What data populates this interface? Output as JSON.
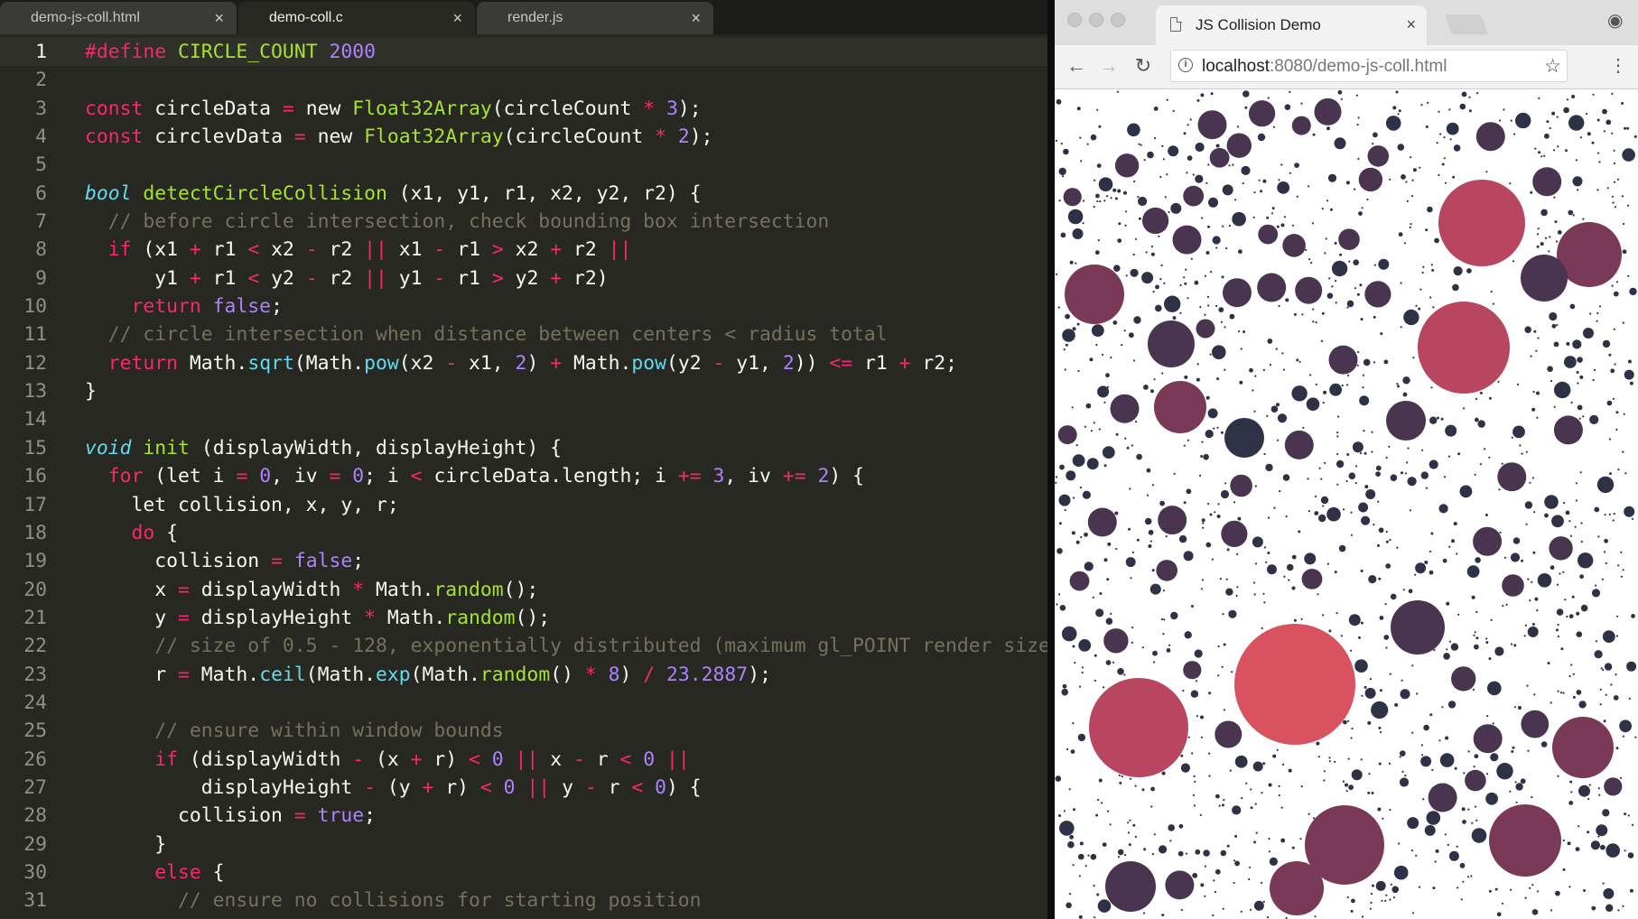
{
  "editor": {
    "tabs": [
      {
        "label": "demo-js-coll.html",
        "close": "×",
        "active": false
      },
      {
        "label": "demo-coll.c",
        "close": "×",
        "active": true
      },
      {
        "label": "render.js",
        "close": "×",
        "active": false
      }
    ],
    "current_line": 1,
    "lines": [
      {
        "n": "1",
        "segs": [
          [
            "kw",
            "#define "
          ],
          [
            "fn",
            "CIRCLE_COUNT "
          ],
          [
            "num",
            "2000"
          ]
        ]
      },
      {
        "n": "2",
        "segs": []
      },
      {
        "n": "3",
        "segs": [
          [
            "kw",
            "const "
          ],
          [
            "",
            "circleData "
          ],
          [
            "kw",
            "= "
          ],
          [
            "",
            "new "
          ],
          [
            "fn",
            "Float32Array"
          ],
          [
            "",
            "(circleCount "
          ],
          [
            "kw",
            "* "
          ],
          [
            "num",
            "3"
          ],
          [
            "",
            ");"
          ]
        ]
      },
      {
        "n": "4",
        "segs": [
          [
            "kw",
            "const "
          ],
          [
            "",
            "circlevData "
          ],
          [
            "kw",
            "= "
          ],
          [
            "",
            "new "
          ],
          [
            "fn",
            "Float32Array"
          ],
          [
            "",
            "(circleCount "
          ],
          [
            "kw",
            "* "
          ],
          [
            "num",
            "2"
          ],
          [
            "",
            ");"
          ]
        ]
      },
      {
        "n": "5",
        "segs": []
      },
      {
        "n": "6",
        "segs": [
          [
            "italic-kw",
            "bool "
          ],
          [
            "fn",
            "detectCircleCollision "
          ],
          [
            "",
            "(x1, y1, r1, x2, y2, r2) {"
          ]
        ]
      },
      {
        "n": "7",
        "segs": [
          [
            "cm",
            "  // before circle intersection, check bounding box intersection"
          ]
        ]
      },
      {
        "n": "8",
        "segs": [
          [
            "kw",
            "  if "
          ],
          [
            "",
            "(x1 "
          ],
          [
            "kw",
            "+ "
          ],
          [
            "",
            "r1 "
          ],
          [
            "kw",
            "< "
          ],
          [
            "",
            "x2 "
          ],
          [
            "kw",
            "- "
          ],
          [
            "",
            "r2 "
          ],
          [
            "kw",
            "|| "
          ],
          [
            "",
            "x1 "
          ],
          [
            "kw",
            "- "
          ],
          [
            "",
            "r1 "
          ],
          [
            "kw",
            "> "
          ],
          [
            "",
            "x2 "
          ],
          [
            "kw",
            "+ "
          ],
          [
            "",
            "r2 "
          ],
          [
            "kw",
            "||"
          ]
        ]
      },
      {
        "n": "9",
        "segs": [
          [
            "",
            "      y1 "
          ],
          [
            "kw",
            "+ "
          ],
          [
            "",
            "r1 "
          ],
          [
            "kw",
            "< "
          ],
          [
            "",
            "y2 "
          ],
          [
            "kw",
            "- "
          ],
          [
            "",
            "r2 "
          ],
          [
            "kw",
            "|| "
          ],
          [
            "",
            "y1 "
          ],
          [
            "kw",
            "- "
          ],
          [
            "",
            "r1 "
          ],
          [
            "kw",
            "> "
          ],
          [
            "",
            "y2 "
          ],
          [
            "kw",
            "+ "
          ],
          [
            "",
            "r2)"
          ]
        ]
      },
      {
        "n": "10",
        "segs": [
          [
            "kw",
            "    return "
          ],
          [
            "num",
            "false"
          ],
          [
            "",
            ";"
          ]
        ]
      },
      {
        "n": "11",
        "segs": [
          [
            "cm",
            "  // circle intersection when distance between centers < radius total"
          ]
        ]
      },
      {
        "n": "12",
        "segs": [
          [
            "kw",
            "  return "
          ],
          [
            "",
            "Math."
          ],
          [
            "sup",
            "sqrt"
          ],
          [
            "",
            "(Math."
          ],
          [
            "sup",
            "pow"
          ],
          [
            "",
            "(x2 "
          ],
          [
            "kw",
            "- "
          ],
          [
            "",
            "x1, "
          ],
          [
            "num",
            "2"
          ],
          [
            "",
            ") "
          ],
          [
            "kw",
            "+ "
          ],
          [
            "",
            "Math."
          ],
          [
            "sup",
            "pow"
          ],
          [
            "",
            "(y2 "
          ],
          [
            "kw",
            "- "
          ],
          [
            "",
            "y1, "
          ],
          [
            "num",
            "2"
          ],
          [
            "",
            ")) "
          ],
          [
            "kw",
            "<= "
          ],
          [
            "",
            "r1 "
          ],
          [
            "kw",
            "+ "
          ],
          [
            "",
            "r2;"
          ]
        ]
      },
      {
        "n": "13",
        "segs": [
          [
            "",
            "}"
          ]
        ]
      },
      {
        "n": "14",
        "segs": []
      },
      {
        "n": "15",
        "segs": [
          [
            "italic-kw",
            "void "
          ],
          [
            "fn",
            "init "
          ],
          [
            "",
            "(displayWidth, displayHeight) {"
          ]
        ]
      },
      {
        "n": "16",
        "segs": [
          [
            "kw",
            "  for "
          ],
          [
            "",
            "(let i "
          ],
          [
            "kw",
            "= "
          ],
          [
            "num",
            "0"
          ],
          [
            "",
            ", iv "
          ],
          [
            "kw",
            "= "
          ],
          [
            "num",
            "0"
          ],
          [
            "",
            "; i "
          ],
          [
            "kw",
            "< "
          ],
          [
            "",
            "circleData.length; i "
          ],
          [
            "kw",
            "+= "
          ],
          [
            "num",
            "3"
          ],
          [
            "",
            ", iv "
          ],
          [
            "kw",
            "+= "
          ],
          [
            "num",
            "2"
          ],
          [
            "",
            ") {"
          ]
        ]
      },
      {
        "n": "17",
        "segs": [
          [
            "",
            "    let collision, x, y, r;"
          ]
        ]
      },
      {
        "n": "18",
        "segs": [
          [
            "kw",
            "    do "
          ],
          [
            "",
            "{"
          ]
        ]
      },
      {
        "n": "19",
        "segs": [
          [
            "",
            "      collision "
          ],
          [
            "kw",
            "= "
          ],
          [
            "num",
            "false"
          ],
          [
            "",
            ";"
          ]
        ]
      },
      {
        "n": "20",
        "segs": [
          [
            "",
            "      x "
          ],
          [
            "kw",
            "= "
          ],
          [
            "",
            "displayWidth "
          ],
          [
            "kw",
            "* "
          ],
          [
            "",
            "Math."
          ],
          [
            "fn",
            "random"
          ],
          [
            "",
            "();"
          ]
        ]
      },
      {
        "n": "21",
        "segs": [
          [
            "",
            "      y "
          ],
          [
            "kw",
            "= "
          ],
          [
            "",
            "displayHeight "
          ],
          [
            "kw",
            "* "
          ],
          [
            "",
            "Math."
          ],
          [
            "fn",
            "random"
          ],
          [
            "",
            "();"
          ]
        ]
      },
      {
        "n": "22",
        "segs": [
          [
            "cm",
            "      // size of 0.5 - 128, exponentially distributed (maximum gl_POINT render size"
          ]
        ]
      },
      {
        "n": "23",
        "segs": [
          [
            "",
            "      r "
          ],
          [
            "kw",
            "= "
          ],
          [
            "",
            "Math."
          ],
          [
            "sup",
            "ceil"
          ],
          [
            "",
            "(Math."
          ],
          [
            "sup",
            "exp"
          ],
          [
            "",
            "(Math."
          ],
          [
            "fn",
            "random"
          ],
          [
            "",
            "() "
          ],
          [
            "kw",
            "* "
          ],
          [
            "num",
            "8"
          ],
          [
            "",
            ") "
          ],
          [
            "kw",
            "/ "
          ],
          [
            "num",
            "23.2887"
          ],
          [
            "",
            ");"
          ]
        ]
      },
      {
        "n": "24",
        "segs": []
      },
      {
        "n": "25",
        "segs": [
          [
            "cm",
            "      // ensure within window bounds"
          ]
        ]
      },
      {
        "n": "26",
        "segs": [
          [
            "kw",
            "      if "
          ],
          [
            "",
            "(displayWidth "
          ],
          [
            "kw",
            "- "
          ],
          [
            "",
            "(x "
          ],
          [
            "kw",
            "+ "
          ],
          [
            "",
            "r) "
          ],
          [
            "kw",
            "< "
          ],
          [
            "num",
            "0 "
          ],
          [
            "kw",
            "|| "
          ],
          [
            "",
            "x "
          ],
          [
            "kw",
            "- "
          ],
          [
            "",
            "r "
          ],
          [
            "kw",
            "< "
          ],
          [
            "num",
            "0 "
          ],
          [
            "kw",
            "||"
          ]
        ]
      },
      {
        "n": "27",
        "segs": [
          [
            "",
            "          displayHeight "
          ],
          [
            "kw",
            "- "
          ],
          [
            "",
            "(y "
          ],
          [
            "kw",
            "+ "
          ],
          [
            "",
            "r) "
          ],
          [
            "kw",
            "< "
          ],
          [
            "num",
            "0 "
          ],
          [
            "kw",
            "|| "
          ],
          [
            "",
            "y "
          ],
          [
            "kw",
            "- "
          ],
          [
            "",
            "r "
          ],
          [
            "kw",
            "< "
          ],
          [
            "num",
            "0"
          ],
          [
            "",
            ") {"
          ]
        ]
      },
      {
        "n": "28",
        "segs": [
          [
            "",
            "        collision "
          ],
          [
            "kw",
            "= "
          ],
          [
            "num",
            "true"
          ],
          [
            "",
            ";"
          ]
        ]
      },
      {
        "n": "29",
        "segs": [
          [
            "",
            "      }"
          ]
        ]
      },
      {
        "n": "30",
        "segs": [
          [
            "kw",
            "      else "
          ],
          [
            "",
            "{"
          ]
        ]
      },
      {
        "n": "31",
        "segs": [
          [
            "cm",
            "        // ensure no collisions for starting position"
          ]
        ]
      }
    ]
  },
  "browser": {
    "tab_title": "JS Collision Demo",
    "tab_close": "×",
    "url_host": "localhost",
    "url_path": ":8080/demo-js-coll.html",
    "icons": {
      "back": "←",
      "forward": "→",
      "reload": "↻",
      "info": "i",
      "star": "☆",
      "menu": "⋮",
      "profile": "◉"
    },
    "colors": {
      "background": "#ffffff",
      "small_circle": "#2f3147",
      "medium_circle": "#4a3550",
      "large_circle_a": "#7a3a57",
      "large_circle_b": "#b84660",
      "largest_circle": "#d9525f"
    }
  }
}
